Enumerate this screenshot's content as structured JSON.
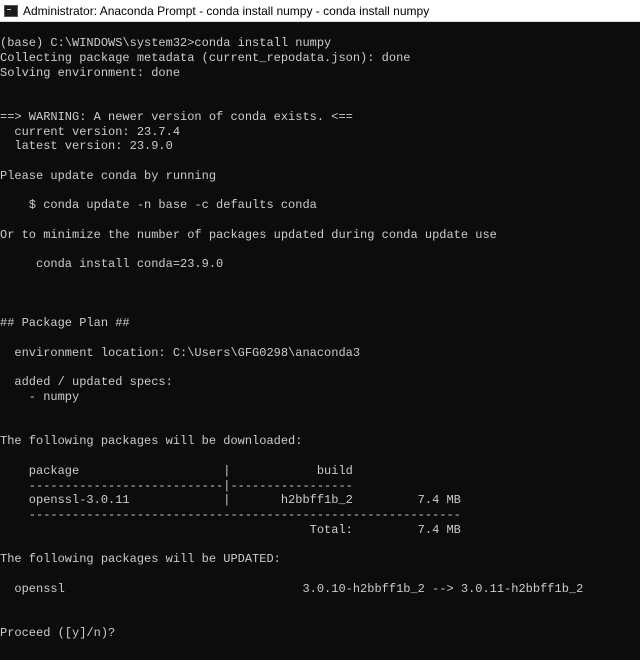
{
  "window": {
    "title": "Administrator: Anaconda Prompt - conda  install numpy - conda  install numpy",
    "icon": "console-window-icon"
  },
  "console": {
    "lines": [
      "(base) C:\\WINDOWS\\system32>conda install numpy",
      "Collecting package metadata (current_repodata.json): done",
      "Solving environment: done",
      "",
      "",
      "==> WARNING: A newer version of conda exists. <==",
      "  current version: 23.7.4",
      "  latest version: 23.9.0",
      "",
      "Please update conda by running",
      "",
      "    $ conda update -n base -c defaults conda",
      "",
      "Or to minimize the number of packages updated during conda update use",
      "",
      "     conda install conda=23.9.0",
      "",
      "",
      "",
      "## Package Plan ##",
      "",
      "  environment location: C:\\Users\\GFG0298\\anaconda3",
      "",
      "  added / updated specs:",
      "    - numpy",
      "",
      "",
      "The following packages will be downloaded:",
      "",
      "    package                    |            build",
      "    ---------------------------|-----------------",
      "    openssl-3.0.11             |       h2bbff1b_2         7.4 MB",
      "    ------------------------------------------------------------",
      "                                           Total:         7.4 MB",
      "",
      "The following packages will be UPDATED:",
      "",
      "  openssl                                 3.0.10-h2bbff1b_2 --> 3.0.11-h2bbff1b_2",
      "",
      "",
      "Proceed ([y]/n)?"
    ]
  }
}
